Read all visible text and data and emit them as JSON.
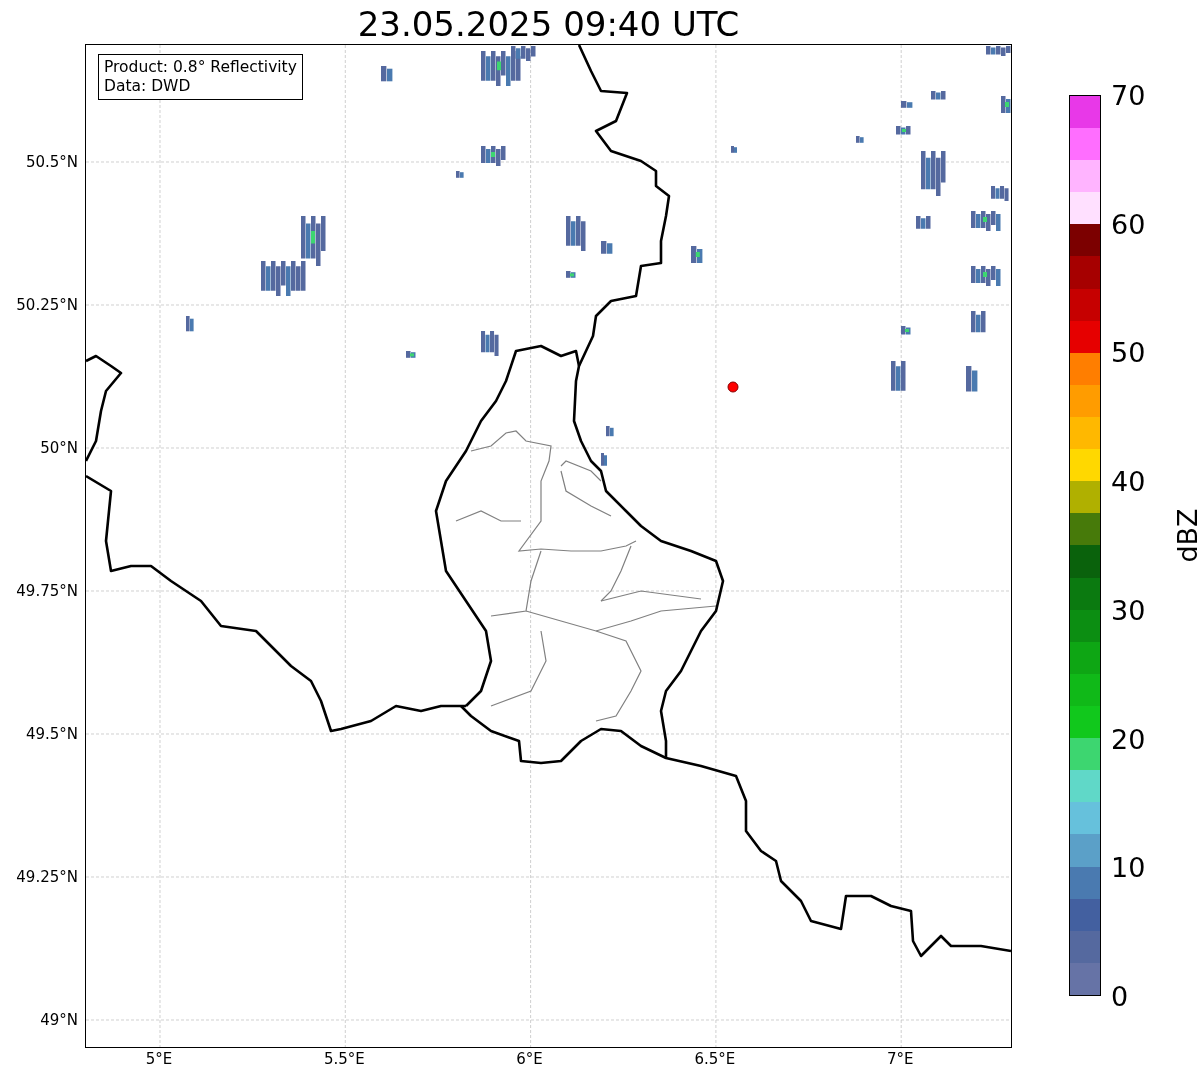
{
  "title": "23.05.2025 09:40 UTC",
  "annotation": {
    "lines": [
      "Product: 0.8° Reflectivity",
      "Data: DWD"
    ]
  },
  "map": {
    "lat_ticks": [
      "50.5°N",
      "50.25°N",
      "50°N",
      "49.75°N",
      "49.5°N",
      "49.25°N",
      "49°N"
    ],
    "lon_ticks": [
      "5°E",
      "5.5°E",
      "6°E",
      "6.5°E",
      "7°E"
    ]
  },
  "colorbar": {
    "label": "dBZ",
    "ticks": [
      "70",
      "60",
      "50",
      "40",
      "30",
      "20",
      "10",
      "0"
    ],
    "bins": [
      {
        "color": "#6673a6"
      },
      {
        "color": "#55699f"
      },
      {
        "color": "#4360a0"
      },
      {
        "color": "#4a7ab0"
      },
      {
        "color": "#5ba0c8"
      },
      {
        "color": "#66c1dc"
      },
      {
        "color": "#60d8c8"
      },
      {
        "color": "#3dd670"
      },
      {
        "color": "#11c81c"
      },
      {
        "color": "#10b918"
      },
      {
        "color": "#0ea614"
      },
      {
        "color": "#0c8e12"
      },
      {
        "color": "#0b7a10"
      },
      {
        "color": "#0a620c"
      },
      {
        "color": "#477a0a"
      },
      {
        "color": "#b0b000"
      },
      {
        "color": "#ffd800"
      },
      {
        "color": "#ffb800"
      },
      {
        "color": "#ff9c00"
      },
      {
        "color": "#ff7e00"
      },
      {
        "color": "#e60000"
      },
      {
        "color": "#c60000"
      },
      {
        "color": "#a60000"
      },
      {
        "color": "#7c0000"
      },
      {
        "color": "#ffe0ff"
      },
      {
        "color": "#ffb4ff"
      },
      {
        "color": "#ff6eff"
      },
      {
        "color": "#e838e8"
      }
    ]
  }
}
